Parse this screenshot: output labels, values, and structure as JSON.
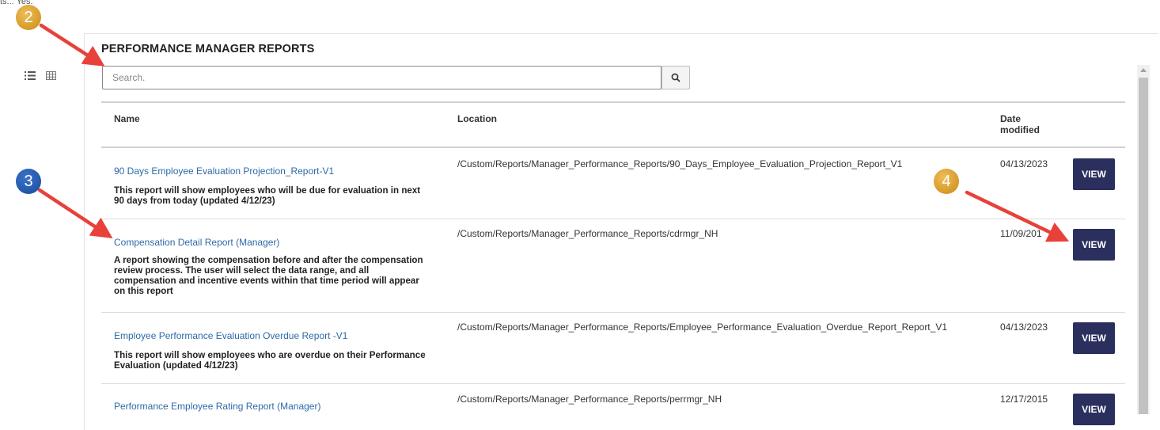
{
  "top_cut_text": "ts... Yes.",
  "view_toggle": {
    "list_icon": "list-view-icon",
    "grid_icon": "grid-view-icon"
  },
  "page_title": "PERFORMANCE MANAGER REPORTS",
  "search": {
    "placeholder": "Search.",
    "value": "",
    "icon": "search-icon"
  },
  "columns": {
    "name": "Name",
    "location": "Location",
    "date_line1": "Date",
    "date_line2": "modified"
  },
  "reports": [
    {
      "name": "90 Days Employee Evaluation Projection_Report-V1",
      "description": "This report will show employees who will be due for evaluation in next 90 days from today (updated 4/12/23)",
      "location": "/Custom/Reports/Manager_Performance_Reports/90_Days_Employee_Evaluation_Projection_Report_V1",
      "date": "04/13/2023",
      "button": "VIEW"
    },
    {
      "name": "Compensation Detail Report (Manager)",
      "description": "A report showing the compensation before and after the compensation review process. The user will select the data range, and all compensation and incentive events within that time period will appear on this report",
      "location": "/Custom/Reports/Manager_Performance_Reports/cdrmgr_NH",
      "date": "11/09/201",
      "button": "VIEW"
    },
    {
      "name": "Employee Performance Evaluation Overdue Report -V1",
      "description": "This report will show employees who are overdue on their Performance Evaluation (updated 4/12/23)",
      "location": "/Custom/Reports/Manager_Performance_Reports/Employee_Performance_Evaluation_Overdue_Report_Report_V1",
      "date": "04/13/2023",
      "button": "VIEW"
    },
    {
      "name": "Performance Employee Rating Report (Manager)",
      "description": "",
      "location": "/Custom/Reports/Manager_Performance_Reports/perrmgr_NH",
      "date": "12/17/2015",
      "button": "VIEW"
    }
  ],
  "annotations": [
    {
      "label": "2",
      "color": "#d99a1e"
    },
    {
      "label": "3",
      "color": "#1f5bb0"
    },
    {
      "label": "4",
      "color": "#d99a1e"
    }
  ],
  "arrow_color": "#e8413a"
}
